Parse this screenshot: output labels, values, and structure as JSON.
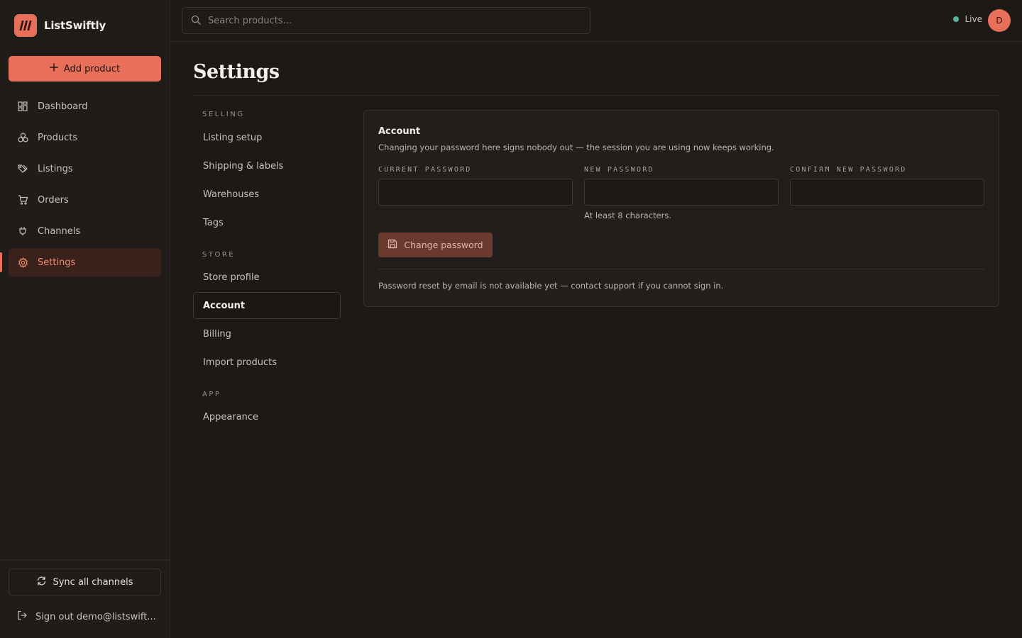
{
  "app": {
    "name": "ListSwiftly",
    "accent": "#e8705a"
  },
  "sidebar": {
    "add_label": "Add product",
    "items": [
      {
        "label": "Dashboard",
        "icon": "dashboard-icon"
      },
      {
        "label": "Products",
        "icon": "products-icon"
      },
      {
        "label": "Listings",
        "icon": "tag-icon"
      },
      {
        "label": "Orders",
        "icon": "cart-icon"
      },
      {
        "label": "Channels",
        "icon": "plug-icon"
      },
      {
        "label": "Settings",
        "icon": "gear-icon",
        "active": true
      }
    ],
    "sync_label": "Sync all channels",
    "signout_label": "Sign out demo@listswift..."
  },
  "topbar": {
    "search_placeholder": "Search products...",
    "status": "Live",
    "status_color": "#58b39a",
    "avatar_initial": "D"
  },
  "page": {
    "title": "Settings"
  },
  "subnav": {
    "groups": [
      {
        "label": "SELLING",
        "items": [
          "Listing setup",
          "Shipping & labels",
          "Warehouses",
          "Tags"
        ]
      },
      {
        "label": "STORE",
        "items": [
          "Store profile",
          "Account",
          "Billing",
          "Import products"
        ]
      },
      {
        "label": "APP",
        "items": [
          "Appearance"
        ]
      }
    ],
    "active": "Account"
  },
  "account": {
    "title": "Account",
    "description": "Changing your password here signs nobody out — the session you are using now keeps working.",
    "fields": [
      {
        "label": "CURRENT PASSWORD",
        "value": ""
      },
      {
        "label": "NEW PASSWORD",
        "value": "",
        "hint": "At least 8 characters."
      },
      {
        "label": "CONFIRM NEW PASSWORD",
        "value": ""
      }
    ],
    "button_label": "Change password",
    "note": "Password reset by email is not available yet — contact support if you cannot sign in."
  }
}
